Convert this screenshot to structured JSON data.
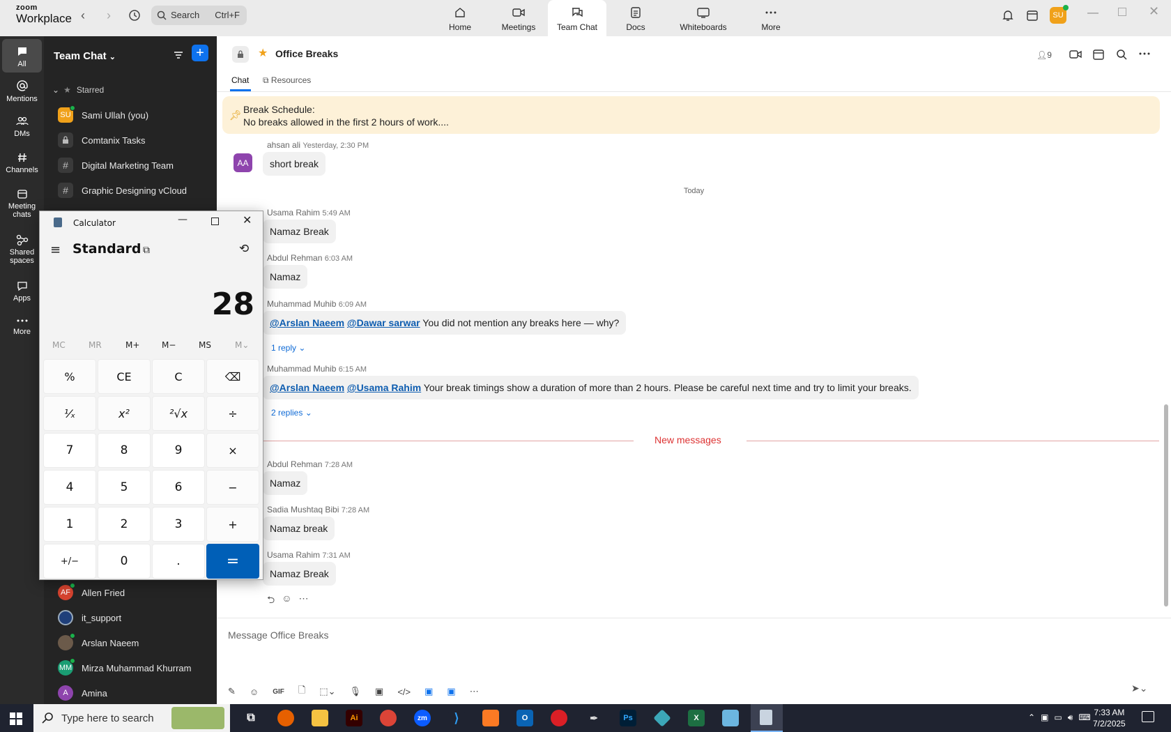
{
  "app": {
    "brand_line1": "zoom",
    "brand_line2": "Workplace"
  },
  "search": {
    "label": "Search",
    "shortcut": "Ctrl+F"
  },
  "nav_tabs": [
    {
      "label": "Home"
    },
    {
      "label": "Meetings"
    },
    {
      "label": "Team Chat"
    },
    {
      "label": "Docs"
    },
    {
      "label": "Whiteboards"
    },
    {
      "label": "More"
    }
  ],
  "user_avatar": "SU",
  "rail": [
    {
      "label": "All"
    },
    {
      "label": "Mentions"
    },
    {
      "label": "DMs"
    },
    {
      "label": "Channels"
    },
    {
      "label": "Meeting chats"
    },
    {
      "label": "Shared spaces"
    },
    {
      "label": "Apps"
    },
    {
      "label": "More"
    }
  ],
  "sidebar": {
    "title": "Team Chat",
    "starred_label": "Starred",
    "items": [
      {
        "initials": "SU",
        "label": "Sami Ullah (you)",
        "color": "#f0a11a"
      },
      {
        "initials": "",
        "label": "Comtanix Tasks"
      },
      {
        "initials": "#",
        "label": "Digital Marketing Team"
      },
      {
        "initials": "#",
        "label": "Graphic Designing vCloud"
      },
      {
        "initials": "AF",
        "label": "Allen Fried",
        "color": "#d5432f"
      },
      {
        "initials": "",
        "label": "it_support"
      },
      {
        "initials": "",
        "label": "Arslan Naeem"
      },
      {
        "initials": "MM",
        "label": "Mirza Muhammad Khurram",
        "color": "#1a9d73"
      },
      {
        "initials": "A",
        "label": "Amina",
        "color": "#8e44ad"
      }
    ]
  },
  "channel": {
    "name": "Office Breaks",
    "members": "9",
    "tab_chat": "Chat",
    "tab_resources": "Resources"
  },
  "pinned": {
    "line1": "Break Schedule:",
    "line2": "No breaks allowed in the first 2 hours of work...."
  },
  "messages": [
    {
      "name": "ahsan ali",
      "time": "Yesterday, 2:30 PM",
      "text": "short break",
      "avatar": "AA"
    },
    {
      "name": "Usama Rahim",
      "time": "5:49 AM",
      "text": "Namaz Break"
    },
    {
      "name": "Abdul Rehman",
      "time": "6:03 AM",
      "text": "Namaz"
    },
    {
      "name": "Muhammad Muhib",
      "time": "6:09 AM",
      "m1": "@Arslan Naeem",
      "m2": "@Dawar sarwar",
      "text": " You did not mention any breaks here — why?",
      "reply": "1 reply"
    },
    {
      "name": "Muhammad Muhib",
      "time": "6:15 AM",
      "m1": "@Arslan Naeem",
      "m2": "@Usama Rahim",
      "text": " Your break timings show a duration of more than 2 hours. Please be careful next time and try to limit your breaks.",
      "reply": "2 replies"
    },
    {
      "name": "Abdul Rehman",
      "time": "7:28 AM",
      "text": "Namaz"
    },
    {
      "name": "Sadia Mushtaq Bibi",
      "time": "7:28 AM",
      "text": "Namaz break"
    },
    {
      "name": "Usama Rahim",
      "time": "7:31 AM",
      "text": "Namaz Break"
    }
  ],
  "today_label": "Today",
  "new_messages_label": "New messages",
  "composer": {
    "placeholder": "Message Office Breaks",
    "gif": "GIF"
  },
  "calculator": {
    "title": "Calculator",
    "mode": "Standard",
    "display": "28",
    "memory": [
      "MC",
      "MR",
      "M+",
      "M−",
      "MS",
      "M⌄"
    ],
    "keys": [
      [
        "%",
        "CE",
        "C",
        "⌫"
      ],
      [
        "¹⁄ₓ",
        "x²",
        "²√x",
        "÷"
      ],
      [
        "7",
        "8",
        "9",
        "×"
      ],
      [
        "4",
        "5",
        "6",
        "−"
      ],
      [
        "1",
        "2",
        "3",
        "+"
      ],
      [
        "+/−",
        "0",
        ".",
        "="
      ]
    ]
  },
  "taskbar": {
    "search_placeholder": "Type here to search",
    "time": "7:33 AM",
    "date": "7/2/2025"
  }
}
